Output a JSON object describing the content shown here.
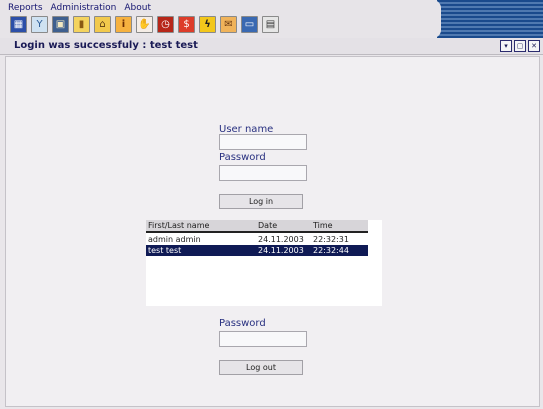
{
  "menu": {
    "reports": "Reports",
    "administration": "Administration",
    "about": "About"
  },
  "toolbar": [
    {
      "icon": "chart-icon",
      "glyph": "▦"
    },
    {
      "icon": "cocktail-icon",
      "glyph": "Y"
    },
    {
      "icon": "presentation-icon",
      "glyph": "▣"
    },
    {
      "icon": "dispenser-icon",
      "glyph": "▮"
    },
    {
      "icon": "lock-icon",
      "glyph": "⌂"
    },
    {
      "icon": "info-icon",
      "glyph": "i"
    },
    {
      "icon": "hand-icon",
      "glyph": "✋"
    },
    {
      "icon": "clock-icon",
      "glyph": "◷"
    },
    {
      "icon": "money-icon",
      "glyph": "$"
    },
    {
      "icon": "lightning-icon",
      "glyph": "ϟ"
    },
    {
      "icon": "handshake-icon",
      "glyph": "✉"
    },
    {
      "icon": "display-icon",
      "glyph": "▭"
    },
    {
      "icon": "document-icon",
      "glyph": "▤"
    }
  ],
  "window": {
    "title": "Login was successfuly : test test",
    "minimize": "▾",
    "maximize": "▢",
    "close": "✕"
  },
  "login": {
    "username_label": "User name",
    "username_value": "",
    "password_label": "Password",
    "password_value": "",
    "login_button": "Log in"
  },
  "sessions": {
    "headers": [
      "First/Last name",
      "Date",
      "Time"
    ],
    "rows": [
      {
        "name": "admin admin",
        "date": "24.11.2003",
        "time": "22:32:31"
      },
      {
        "name": "test test",
        "date": "24.11.2003",
        "time": "22:32:44"
      }
    ]
  },
  "logout": {
    "password_label": "Password",
    "password_value": "",
    "logout_button": "Log out"
  }
}
